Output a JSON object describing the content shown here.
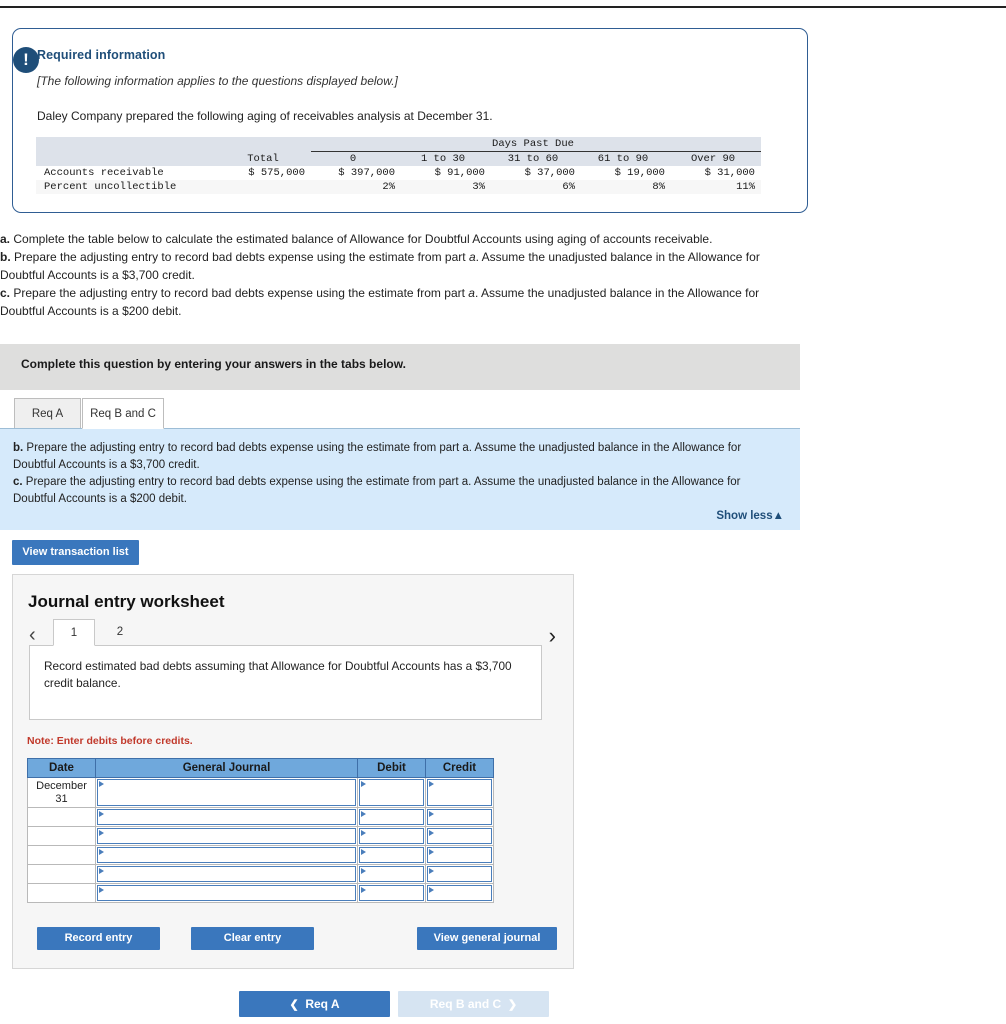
{
  "alert": {
    "icon": "exclamation-icon",
    "glyph": "!"
  },
  "required_info": {
    "title": "Required information",
    "applies_note": "[The following information applies to the questions displayed below.]",
    "lead": "Daley Company prepared the following aging of receivables analysis at December 31."
  },
  "aging_table": {
    "group_header": "Days Past Due",
    "columns": [
      "",
      "Total",
      "0",
      "1 to 30",
      "31 to 60",
      "61 to 90",
      "Over 90"
    ],
    "rows": [
      {
        "label": "Accounts receivable",
        "values": [
          "$ 575,000",
          "$ 397,000",
          "$ 91,000",
          "$ 37,000",
          "$ 19,000",
          "$ 31,000"
        ]
      },
      {
        "label": "Percent uncollectible",
        "values": [
          "",
          "2%",
          "3%",
          "6%",
          "8%",
          "11%"
        ]
      }
    ]
  },
  "question_parts": {
    "a_label": "a.",
    "a_text": " Complete the table below to calculate the estimated balance of Allowance for Doubtful Accounts using aging of accounts receivable.",
    "b_label": "b.",
    "b_text_1": " Prepare the adjusting entry to record bad debts expense using the estimate from part ",
    "b_italic": "a",
    "b_text_2": ". Assume the unadjusted balance in the Allowance for Doubtful Accounts is a $3,700 credit.",
    "c_label": "c.",
    "c_text_1": " Prepare the adjusting entry to record bad debts expense using the estimate from part ",
    "c_italic": "a",
    "c_text_2": ". Assume the unadjusted balance in the Allowance for Doubtful Accounts is a $200 debit."
  },
  "instruction_bar": {
    "text": "Complete this question by entering your answers in the tabs below."
  },
  "tabs": [
    {
      "label": "Req A",
      "active": false
    },
    {
      "label": "Req B and C",
      "active": true
    }
  ],
  "blue_panel": {
    "b_label": "b.",
    "b_text": " Prepare the adjusting entry to record bad debts expense using the estimate from part a. Assume the unadjusted balance in the Allowance for Doubtful Accounts is a $3,700 credit.",
    "c_label": "c.",
    "c_text": " Prepare the adjusting entry to record bad debts expense using the estimate from part a. Assume the unadjusted balance in the Allowance for Doubtful Accounts is a $200 debit.",
    "show_less": "Show less",
    "show_less_caret": "▲"
  },
  "buttons": {
    "view_transaction_list": "View transaction list",
    "record_entry": "Record entry",
    "clear_entry": "Clear entry",
    "view_general_journal": "View general journal"
  },
  "worksheet": {
    "title": "Journal entry worksheet",
    "prev_arrow": "‹",
    "next_arrow": "›",
    "entry_tabs": [
      {
        "label": "1",
        "active": true
      },
      {
        "label": "2",
        "active": false
      }
    ],
    "prompt": "Record estimated bad debts assuming that Allowance for Doubtful Accounts has a $3,700 credit balance.",
    "note": "Note: Enter debits before credits.",
    "journal": {
      "headers": [
        "Date",
        "General Journal",
        "Debit",
        "Credit"
      ],
      "rows": [
        {
          "date": "December 31",
          "general_journal": "",
          "debit": "",
          "credit": ""
        },
        {
          "date": "",
          "general_journal": "",
          "debit": "",
          "credit": ""
        },
        {
          "date": "",
          "general_journal": "",
          "debit": "",
          "credit": ""
        },
        {
          "date": "",
          "general_journal": "",
          "debit": "",
          "credit": ""
        },
        {
          "date": "",
          "general_journal": "",
          "debit": "",
          "credit": ""
        },
        {
          "date": "",
          "general_journal": "",
          "debit": "",
          "credit": ""
        }
      ]
    }
  },
  "pager": {
    "prev_label": "Req A",
    "prev_chevron": "❮",
    "next_label": "Req B and C",
    "next_chevron": "❯"
  },
  "colors": {
    "accent_blue": "#3a77bd",
    "navy": "#1f4e79",
    "panel_blue": "#d6eafb",
    "table_header_blue": "#6fa8dc",
    "gray_bar": "#dededd",
    "note_red": "#c1392b"
  }
}
